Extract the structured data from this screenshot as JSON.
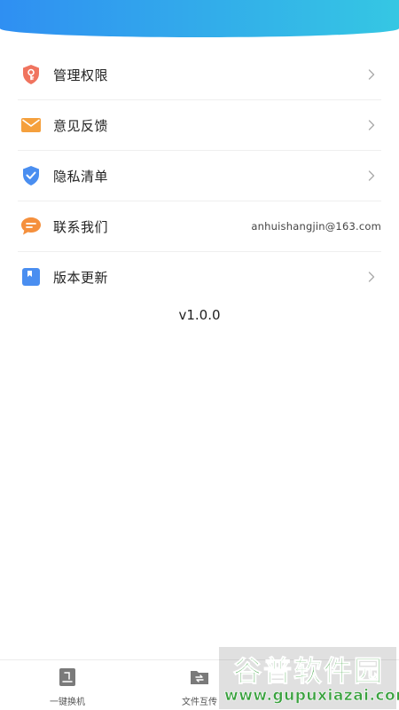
{
  "menu": {
    "items": [
      {
        "icon": "key-shield-icon",
        "label": "管理权限",
        "has_chevron": true
      },
      {
        "icon": "envelope-icon",
        "label": "意见反馈",
        "has_chevron": true
      },
      {
        "icon": "check-shield-icon",
        "label": "隐私清单",
        "has_chevron": true
      },
      {
        "icon": "chat-bubble-icon",
        "label": "联系我们",
        "value": "anhuishangjin@163.com"
      },
      {
        "icon": "bookmark-icon",
        "label": "版本更新",
        "has_chevron": true
      }
    ]
  },
  "version": "v1.0.0",
  "bottom_nav": {
    "items": [
      {
        "icon": "phone-transfer-icon",
        "label": "一键换机"
      },
      {
        "icon": "folder-transfer-icon",
        "label": "文件互传"
      }
    ]
  },
  "watermark": {
    "title": "谷普软件园",
    "url": "www.gupuxiazai.com"
  },
  "colors": {
    "banner_start": "#2f8ff2",
    "banner_end": "#35c7e3",
    "key_icon": "#f0745f",
    "mail_icon": "#f5a03d",
    "shield_icon": "#4a8ef0",
    "chat_icon": "#f5903d",
    "bookmark_icon": "#4a8ef0"
  }
}
